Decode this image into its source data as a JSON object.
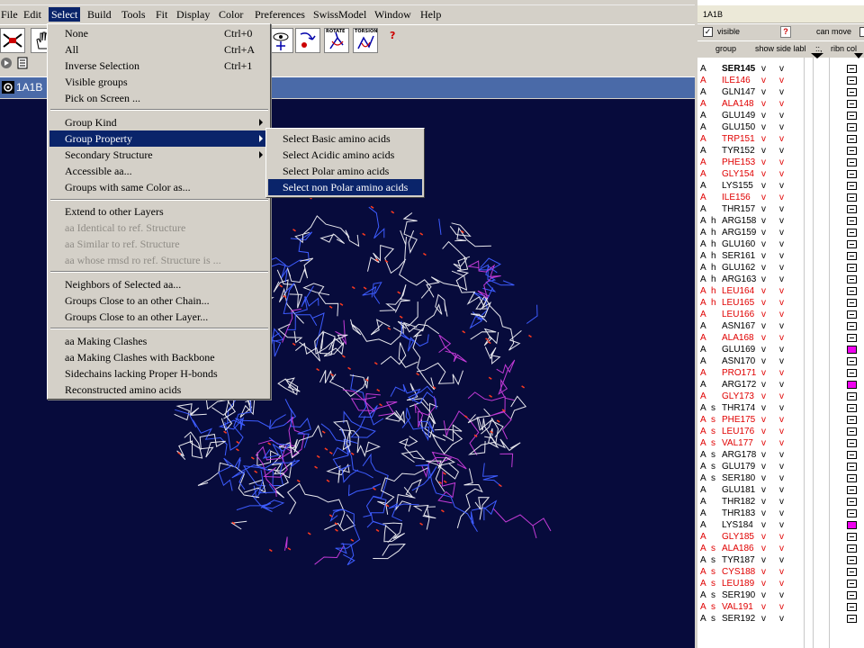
{
  "menubar": [
    "File",
    "Edit",
    "Select",
    "Build",
    "Tools",
    "Fit",
    "Display",
    "Color",
    "Preferences",
    "SwissModel",
    "Window",
    "Help"
  ],
  "menubar_active": "Select",
  "toolbar": {
    "rotate_label": "ROTATE",
    "torsion_label": "TORSION",
    "help": "?"
  },
  "viewer": {
    "title": "1A1B"
  },
  "select_menu": {
    "items": [
      {
        "label": "None",
        "shortcut": "Ctrl+0"
      },
      {
        "label": "All",
        "shortcut": "Ctrl+A"
      },
      {
        "label": "Inverse Selection",
        "shortcut": "Ctrl+1"
      },
      {
        "label": "Visible groups"
      },
      {
        "label": "Pick on Screen ..."
      },
      {
        "label": "Group Kind",
        "submenu": true
      },
      {
        "label": "Group Property",
        "submenu": true,
        "highlighted": true
      },
      {
        "label": "Secondary Structure",
        "submenu": true
      },
      {
        "label": "Accessible aa..."
      },
      {
        "label": "Groups with same Color as..."
      },
      {
        "label": "Extend to other Layers"
      },
      {
        "label": "aa Identical to ref. Structure",
        "disabled": true
      },
      {
        "label": "aa Similar to ref. Structure",
        "disabled": true
      },
      {
        "label": "aa whose rmsd ro ref. Structure is ...",
        "disabled": true
      },
      {
        "label": "Neighbors of Selected aa..."
      },
      {
        "label": "Groups Close to an other Chain..."
      },
      {
        "label": "Groups Close to an other Layer..."
      },
      {
        "label": "aa Making Clashes"
      },
      {
        "label": "aa Making Clashes with Backbone"
      },
      {
        "label": "Sidechains lacking Proper H-bonds"
      },
      {
        "label": "Reconstructed amino acids"
      }
    ]
  },
  "submenu": {
    "items": [
      {
        "label": "Select Basic amino acids"
      },
      {
        "label": "Select Acidic amino acids"
      },
      {
        "label": "Select Polar amino acids"
      },
      {
        "label": "Select non Polar amino acids",
        "highlighted": true
      }
    ]
  },
  "panel": {
    "title": "1A1B",
    "visible_label": "visible",
    "help": "?",
    "can_move_label": "can move",
    "headers": {
      "group": "group",
      "side": "show side labl",
      "sym": "::,",
      "ribn": "ribn col"
    },
    "rows": [
      {
        "chain": "A",
        "ss": "",
        "name": "SER145",
        "v1": "v",
        "v2": "v",
        "red": false,
        "bold": true,
        "mag": false
      },
      {
        "chain": "A",
        "ss": "",
        "name": "ILE146",
        "v1": "v",
        "v2": "v",
        "red": true,
        "bold": false,
        "mag": false
      },
      {
        "chain": "A",
        "ss": "",
        "name": "GLN147",
        "v1": "v",
        "v2": "v",
        "red": false,
        "bold": false,
        "mag": false
      },
      {
        "chain": "A",
        "ss": "",
        "name": "ALA148",
        "v1": "v",
        "v2": "v",
        "red": true,
        "bold": false,
        "mag": false
      },
      {
        "chain": "A",
        "ss": "",
        "name": "GLU149",
        "v1": "v",
        "v2": "v",
        "red": false,
        "bold": false,
        "mag": false
      },
      {
        "chain": "A",
        "ss": "",
        "name": "GLU150",
        "v1": "v",
        "v2": "v",
        "red": false,
        "bold": false,
        "mag": false
      },
      {
        "chain": "A",
        "ss": "",
        "name": "TRP151",
        "v1": "v",
        "v2": "v",
        "red": true,
        "bold": false,
        "mag": false
      },
      {
        "chain": "A",
        "ss": "",
        "name": "TYR152",
        "v1": "v",
        "v2": "v",
        "red": false,
        "bold": false,
        "mag": false
      },
      {
        "chain": "A",
        "ss": "",
        "name": "PHE153",
        "v1": "v",
        "v2": "v",
        "red": true,
        "bold": false,
        "mag": false
      },
      {
        "chain": "A",
        "ss": "",
        "name": "GLY154",
        "v1": "v",
        "v2": "v",
        "red": true,
        "bold": false,
        "mag": false
      },
      {
        "chain": "A",
        "ss": "",
        "name": "LYS155",
        "v1": "v",
        "v2": "v",
        "red": false,
        "bold": false,
        "mag": false
      },
      {
        "chain": "A",
        "ss": "",
        "name": "ILE156",
        "v1": "v",
        "v2": "v",
        "red": true,
        "bold": false,
        "mag": false
      },
      {
        "chain": "A",
        "ss": "",
        "name": "THR157",
        "v1": "v",
        "v2": "v",
        "red": false,
        "bold": false,
        "mag": false
      },
      {
        "chain": "A",
        "ss": "h",
        "name": "ARG158",
        "v1": "v",
        "v2": "v",
        "red": false,
        "bold": false,
        "mag": false
      },
      {
        "chain": "A",
        "ss": "h",
        "name": "ARG159",
        "v1": "v",
        "v2": "v",
        "red": false,
        "bold": false,
        "mag": false
      },
      {
        "chain": "A",
        "ss": "h",
        "name": "GLU160",
        "v1": "v",
        "v2": "v",
        "red": false,
        "bold": false,
        "mag": false
      },
      {
        "chain": "A",
        "ss": "h",
        "name": "SER161",
        "v1": "v",
        "v2": "v",
        "red": false,
        "bold": false,
        "mag": false
      },
      {
        "chain": "A",
        "ss": "h",
        "name": "GLU162",
        "v1": "v",
        "v2": "v",
        "red": false,
        "bold": false,
        "mag": false
      },
      {
        "chain": "A",
        "ss": "h",
        "name": "ARG163",
        "v1": "v",
        "v2": "v",
        "red": false,
        "bold": false,
        "mag": false
      },
      {
        "chain": "A",
        "ss": "h",
        "name": "LEU164",
        "v1": "v",
        "v2": "v",
        "red": true,
        "bold": false,
        "mag": false
      },
      {
        "chain": "A",
        "ss": "h",
        "name": "LEU165",
        "v1": "v",
        "v2": "v",
        "red": true,
        "bold": false,
        "mag": false
      },
      {
        "chain": "A",
        "ss": "",
        "name": "LEU166",
        "v1": "v",
        "v2": "v",
        "red": true,
        "bold": false,
        "mag": false
      },
      {
        "chain": "A",
        "ss": "",
        "name": "ASN167",
        "v1": "v",
        "v2": "v",
        "red": false,
        "bold": false,
        "mag": false
      },
      {
        "chain": "A",
        "ss": "",
        "name": "ALA168",
        "v1": "v",
        "v2": "v",
        "red": true,
        "bold": false,
        "mag": false
      },
      {
        "chain": "A",
        "ss": "",
        "name": "GLU169",
        "v1": "v",
        "v2": "v",
        "red": false,
        "bold": false,
        "mag": true
      },
      {
        "chain": "A",
        "ss": "",
        "name": "ASN170",
        "v1": "v",
        "v2": "v",
        "red": false,
        "bold": false,
        "mag": false
      },
      {
        "chain": "A",
        "ss": "",
        "name": "PRO171",
        "v1": "v",
        "v2": "v",
        "red": true,
        "bold": false,
        "mag": false
      },
      {
        "chain": "A",
        "ss": "",
        "name": "ARG172",
        "v1": "v",
        "v2": "v",
        "red": false,
        "bold": false,
        "mag": true
      },
      {
        "chain": "A",
        "ss": "",
        "name": "GLY173",
        "v1": "v",
        "v2": "v",
        "red": true,
        "bold": false,
        "mag": false
      },
      {
        "chain": "A",
        "ss": "s",
        "name": "THR174",
        "v1": "v",
        "v2": "v",
        "red": false,
        "bold": false,
        "mag": false
      },
      {
        "chain": "A",
        "ss": "s",
        "name": "PHE175",
        "v1": "v",
        "v2": "v",
        "red": true,
        "bold": false,
        "mag": false
      },
      {
        "chain": "A",
        "ss": "s",
        "name": "LEU176",
        "v1": "v",
        "v2": "v",
        "red": true,
        "bold": false,
        "mag": false
      },
      {
        "chain": "A",
        "ss": "s",
        "name": "VAL177",
        "v1": "v",
        "v2": "v",
        "red": true,
        "bold": false,
        "mag": false
      },
      {
        "chain": "A",
        "ss": "s",
        "name": "ARG178",
        "v1": "v",
        "v2": "v",
        "red": false,
        "bold": false,
        "mag": false
      },
      {
        "chain": "A",
        "ss": "s",
        "name": "GLU179",
        "v1": "v",
        "v2": "v",
        "red": false,
        "bold": false,
        "mag": false
      },
      {
        "chain": "A",
        "ss": "s",
        "name": "SER180",
        "v1": "v",
        "v2": "v",
        "red": false,
        "bold": false,
        "mag": false
      },
      {
        "chain": "A",
        "ss": "",
        "name": "GLU181",
        "v1": "v",
        "v2": "v",
        "red": false,
        "bold": false,
        "mag": false
      },
      {
        "chain": "A",
        "ss": "",
        "name": "THR182",
        "v1": "v",
        "v2": "v",
        "red": false,
        "bold": false,
        "mag": false
      },
      {
        "chain": "A",
        "ss": "",
        "name": "THR183",
        "v1": "v",
        "v2": "v",
        "red": false,
        "bold": false,
        "mag": false
      },
      {
        "chain": "A",
        "ss": "",
        "name": "LYS184",
        "v1": "v",
        "v2": "v",
        "red": false,
        "bold": false,
        "mag": true
      },
      {
        "chain": "A",
        "ss": "",
        "name": "GLY185",
        "v1": "v",
        "v2": "v",
        "red": true,
        "bold": false,
        "mag": false
      },
      {
        "chain": "A",
        "ss": "s",
        "name": "ALA186",
        "v1": "v",
        "v2": "v",
        "red": true,
        "bold": false,
        "mag": false
      },
      {
        "chain": "A",
        "ss": "s",
        "name": "TYR187",
        "v1": "v",
        "v2": "v",
        "red": false,
        "bold": false,
        "mag": false
      },
      {
        "chain": "A",
        "ss": "s",
        "name": "CYS188",
        "v1": "v",
        "v2": "v",
        "red": true,
        "bold": false,
        "mag": false
      },
      {
        "chain": "A",
        "ss": "s",
        "name": "LEU189",
        "v1": "v",
        "v2": "v",
        "red": true,
        "bold": false,
        "mag": false
      },
      {
        "chain": "A",
        "ss": "s",
        "name": "SER190",
        "v1": "v",
        "v2": "v",
        "red": false,
        "bold": false,
        "mag": false
      },
      {
        "chain": "A",
        "ss": "s",
        "name": "VAL191",
        "v1": "v",
        "v2": "v",
        "red": true,
        "bold": false,
        "mag": false
      },
      {
        "chain": "A",
        "ss": "s",
        "name": "SER192",
        "v1": "v",
        "v2": "v",
        "red": false,
        "bold": false,
        "mag": false
      }
    ]
  },
  "colors": {
    "viewport_bg": "#070b3c",
    "highlight": "#0a246a",
    "residue_red": "#e00000",
    "selected_magenta": "#ee00ee",
    "bond_white": "#e8e8ee",
    "bond_blue": "#3d5cff",
    "bond_magenta": "#c23ad6",
    "atom_red": "#ff3a1f"
  },
  "icons": [
    "fit-icon",
    "hand-icon",
    "eye-icon",
    "translate-icon",
    "rotate-icon",
    "torsion-icon",
    "play-icon",
    "document-icon",
    "viewer-logo-icon"
  ]
}
